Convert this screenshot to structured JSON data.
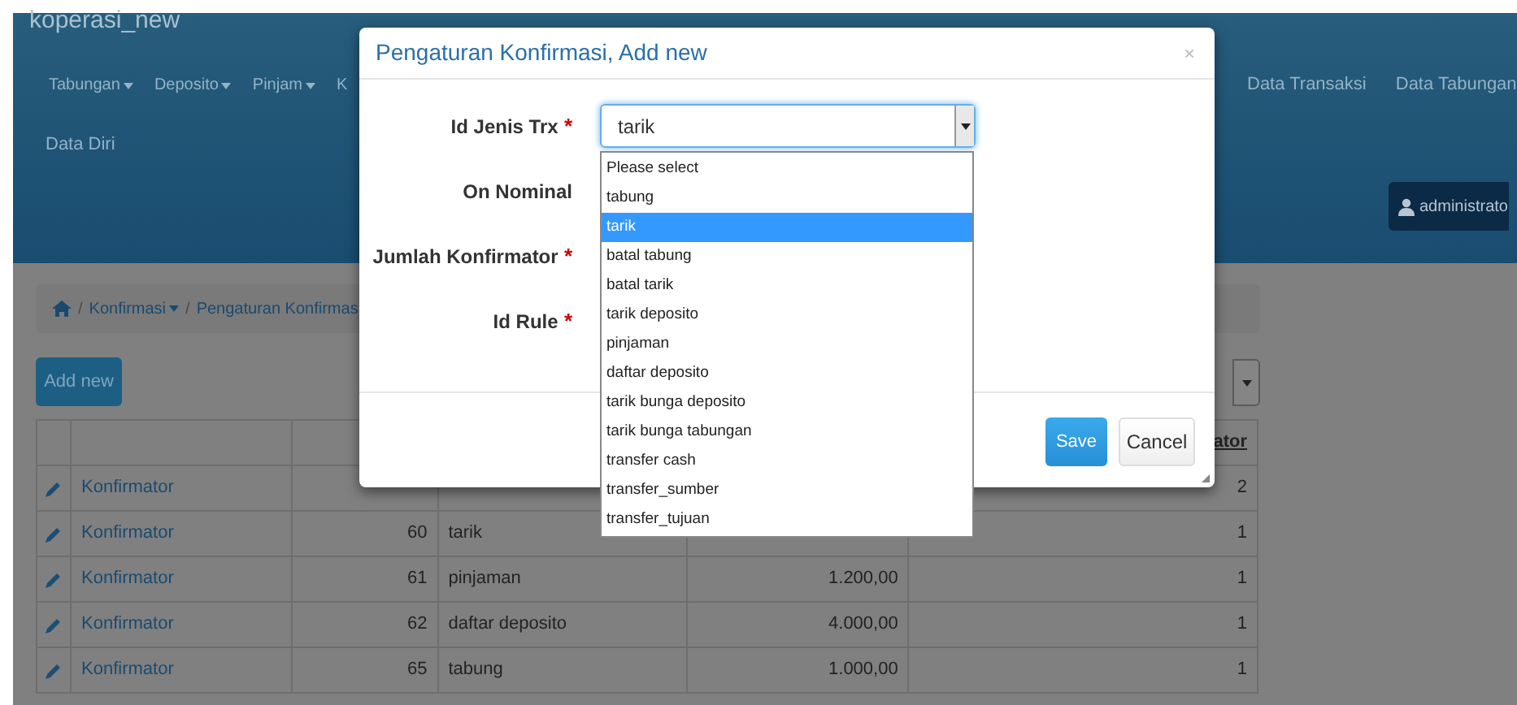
{
  "brand": "koperasi_new",
  "nav": [
    {
      "label": "Tabungan",
      "dropdown": true
    },
    {
      "label": "Deposito",
      "dropdown": true
    },
    {
      "label": "Pinjam",
      "dropdown": true
    },
    {
      "label": "K",
      "dropdown": false
    }
  ],
  "nav_right": [
    "Data Transaksi",
    "Data Tabungan"
  ],
  "nav_second": [
    "Data Diri"
  ],
  "user_button": "administrato",
  "breadcrumb": [
    {
      "separator": "/",
      "label": "Konfirmasi",
      "dropdown": true
    },
    {
      "separator": "/",
      "label": "Pengaturan Konfirmas",
      "dropdown": false
    }
  ],
  "add_button": "Add new",
  "table": {
    "column_6": "ator",
    "rows": [
      {
        "name": "Konfirmator",
        "column_6": "2"
      },
      {
        "name": "Konfirmator",
        "id": "60",
        "jenis": "tarik",
        "column_6": "1"
      },
      {
        "name": "Konfirmator",
        "id": "61",
        "jenis": "pinjaman",
        "nominal": "1.200,00",
        "column_6": "1"
      },
      {
        "name": "Konfirmator",
        "id": "62",
        "jenis": "daftar deposito",
        "nominal": "4.000,00",
        "column_6": "1"
      },
      {
        "name": "Konfirmator",
        "id": "65",
        "jenis": "tabung",
        "nominal": "1.000,00",
        "column_6": "1"
      }
    ]
  },
  "modal": {
    "title": "Pengaturan Konfirmasi, Add new",
    "close": "×",
    "required_mark": "*",
    "fields": [
      {
        "label": "Id Jenis Trx",
        "required": true
      },
      {
        "label": "On Nominal",
        "required": false
      },
      {
        "label": "Jumlah Konfirmator",
        "required": true
      },
      {
        "label": "Id Rule",
        "required": true
      }
    ],
    "select_value": "tarik",
    "options": [
      {
        "label": "Please select",
        "selected": false
      },
      {
        "label": "tabung",
        "selected": false
      },
      {
        "label": "tarik",
        "selected": true
      },
      {
        "label": "batal tabung",
        "selected": false
      },
      {
        "label": "batal tarik",
        "selected": false
      },
      {
        "label": "tarik deposito",
        "selected": false
      },
      {
        "label": "pinjaman",
        "selected": false
      },
      {
        "label": "daftar deposito",
        "selected": false
      },
      {
        "label": "tarik bunga deposito",
        "selected": false
      },
      {
        "label": "tarik bunga tabungan",
        "selected": false
      },
      {
        "label": "transfer cash",
        "selected": false
      },
      {
        "label": "transfer_sumber",
        "selected": false
      },
      {
        "label": "transfer_tujuan",
        "selected": false
      }
    ],
    "buttons": {
      "save": "Save",
      "cancel": "Cancel"
    }
  }
}
